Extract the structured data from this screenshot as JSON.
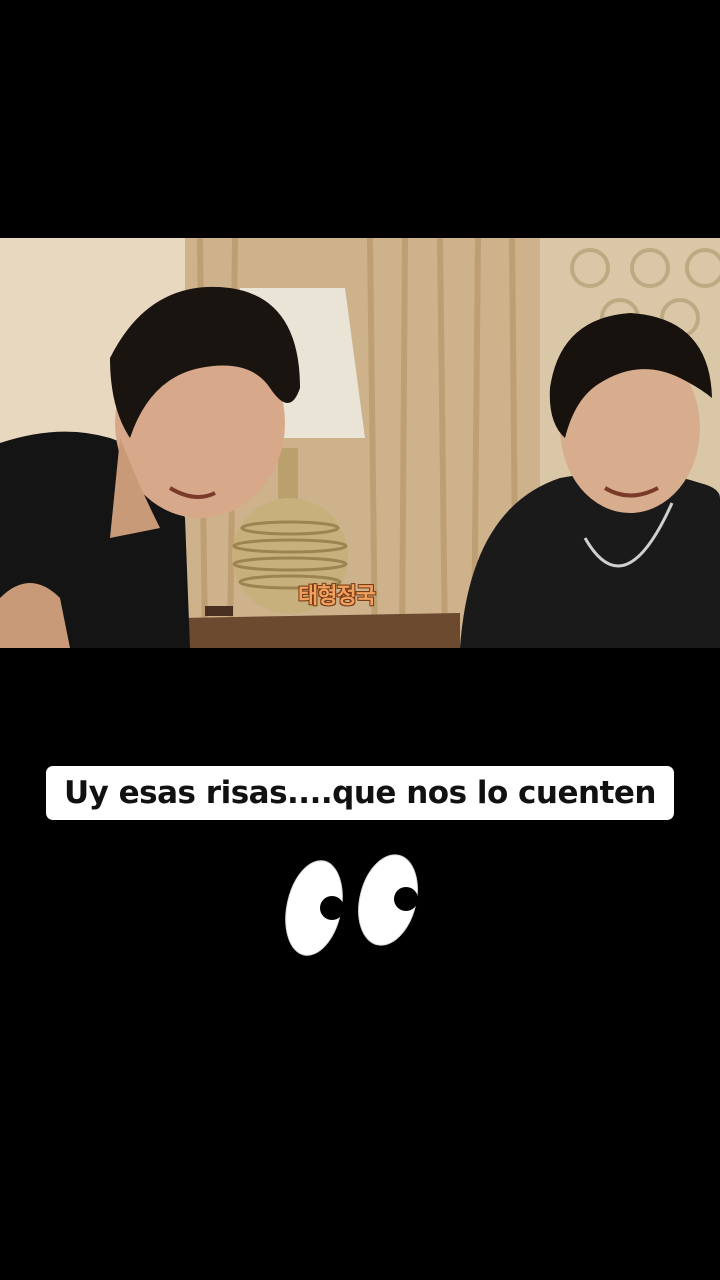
{
  "video": {
    "watermark": "태형정국"
  },
  "caption": {
    "text": "Uy esas risas....que nos lo cuenten"
  },
  "sticker": {
    "icon": "eyes-emoji-icon"
  },
  "colors": {
    "background": "#000000",
    "caption_bg": "#ffffff",
    "caption_text": "#111111",
    "watermark": "#f0a060"
  }
}
